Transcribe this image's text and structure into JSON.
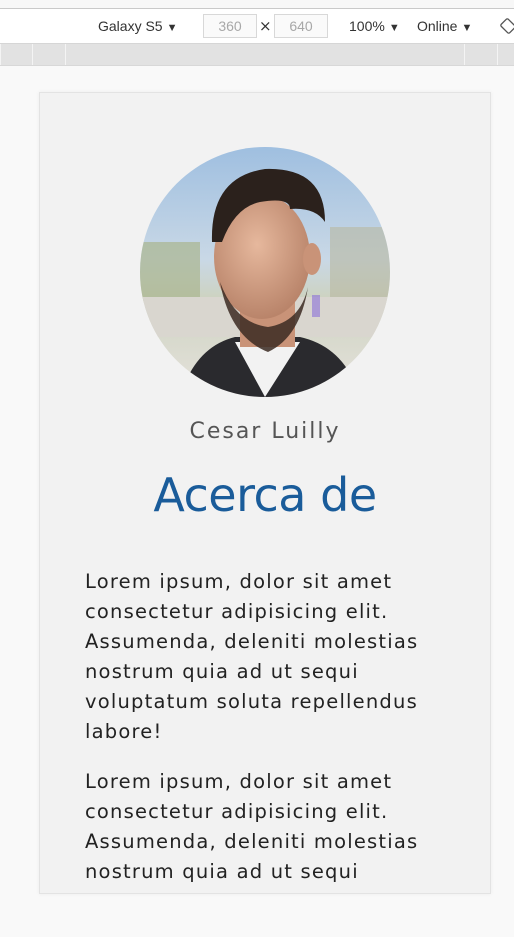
{
  "toolbar": {
    "device": "Galaxy S5",
    "width": "360",
    "height": "640",
    "times": "×",
    "zoom": "100%",
    "network": "Online",
    "rotate_icon": "rotate-device-icon"
  },
  "profile": {
    "name": "Cesar Luilly",
    "heading": "Acerca de",
    "paragraphs": [
      "Lorem ipsum, dolor sit amet consectetur adipisicing elit. Assumenda, deleniti molestias nostrum quia ad ut sequi voluptatum soluta repellendus labore!",
      "Lorem ipsum, dolor sit amet consectetur adipisicing elit. Assumenda, deleniti molestias nostrum quia ad ut sequi"
    ]
  },
  "colors": {
    "heading": "#1a5c9a",
    "card_bg": "#f2f2f2"
  }
}
